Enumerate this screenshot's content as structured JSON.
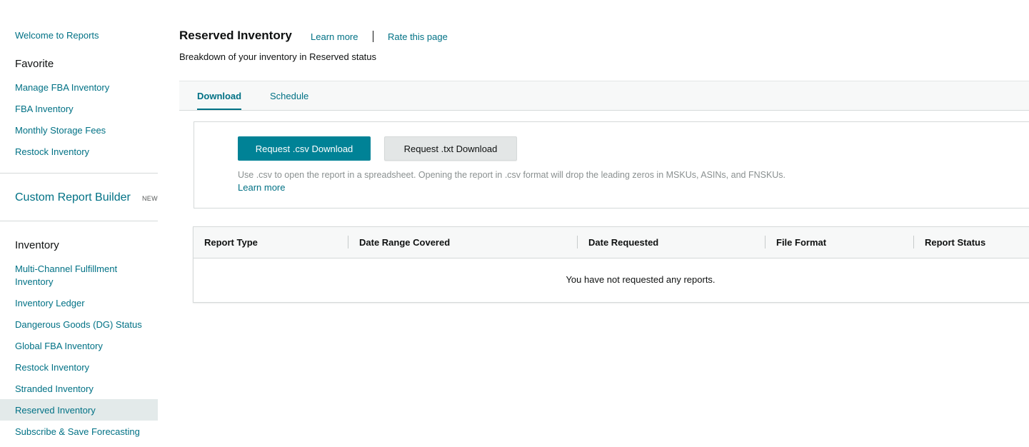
{
  "sidebar": {
    "welcome": "Welcome to Reports",
    "favorite_heading": "Favorite",
    "favorite_items": [
      "Manage FBA Inventory",
      "FBA Inventory",
      "Monthly Storage Fees",
      "Restock Inventory"
    ],
    "custom_report_builder": "Custom Report Builder",
    "new_badge": "NEW",
    "inventory_heading": "Inventory",
    "inventory_items": [
      "Multi-Channel Fulfillment Inventory",
      "Inventory Ledger",
      "Dangerous Goods (DG) Status",
      "Global FBA Inventory",
      "Restock Inventory",
      "Stranded Inventory",
      "Reserved Inventory",
      "Subscribe & Save Forecasting"
    ],
    "active_item": "Reserved Inventory"
  },
  "header": {
    "title": "Reserved Inventory",
    "learn_more": "Learn more",
    "rate_page": "Rate this page",
    "subtitle": "Breakdown of your inventory in Reserved status"
  },
  "tabs": [
    {
      "label": "Download",
      "active": true
    },
    {
      "label": "Schedule",
      "active": false
    }
  ],
  "download": {
    "csv_button": "Request .csv Download",
    "txt_button": "Request .txt Download",
    "note": "Use .csv to open the report in a spreadsheet. Opening the report in .csv format will drop the leading zeros in MSKUs, ASINs, and FNSKUs.",
    "learn_more": "Learn more"
  },
  "reports_table": {
    "columns": [
      "Report Type",
      "Date Range Covered",
      "Date Requested",
      "File Format",
      "Report Status"
    ],
    "empty_message": "You have not requested any reports."
  },
  "colors": {
    "link": "#007185",
    "primary_button": "#008296",
    "secondary_button": "#e3e6e6",
    "active_sidebar_bg": "#e3eaea"
  }
}
